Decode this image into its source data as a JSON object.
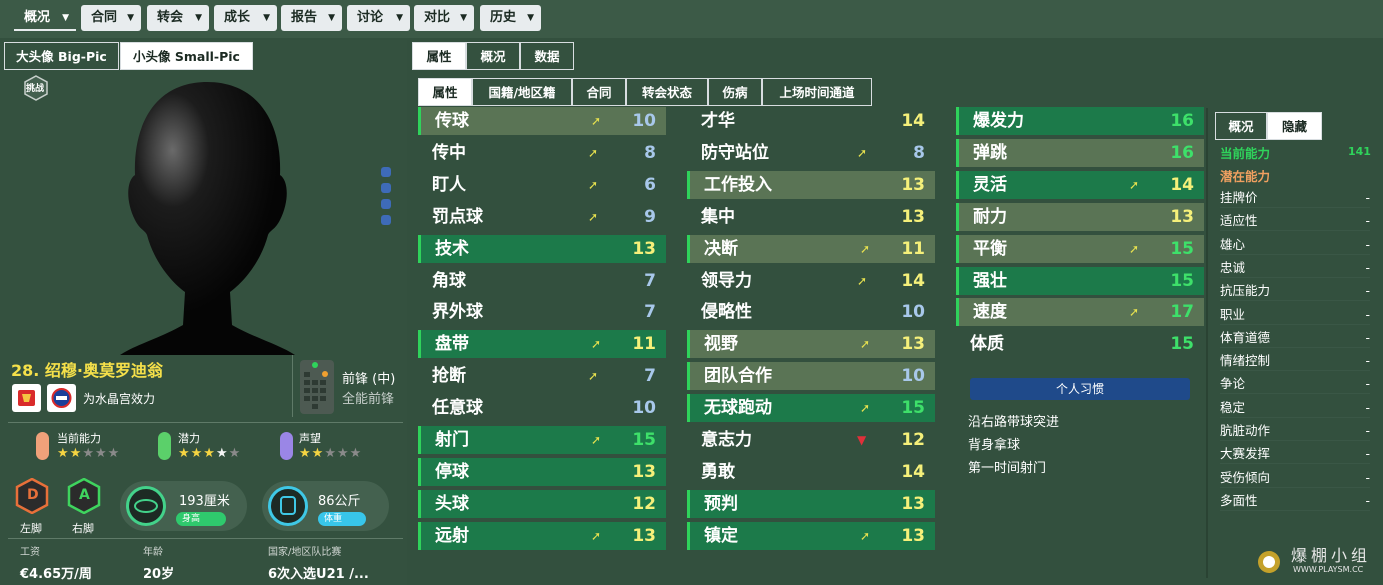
{
  "nav": {
    "items": [
      "概况",
      "合同",
      "转会",
      "成长",
      "报告",
      "讨论",
      "对比",
      "历史"
    ]
  },
  "portrait_tabs": {
    "big": "大头像 Big-Pic",
    "small": "小头像 Small-Pic"
  },
  "challenge_badge": "挑战",
  "player": {
    "name": "28. 绍穆·奥莫罗迪翁",
    "club_text": "为水晶宫效力",
    "position": "前锋 (中)",
    "role": "全能前锋",
    "ca_label": "当前能力",
    "pa_label": "潜力",
    "rep_label": "声望",
    "ca_stars": 2.5,
    "pa_stars": 3.5,
    "rep_stars": 2.5,
    "left_foot_grade": "D",
    "right_foot_grade": "A",
    "left_foot_label": "左脚",
    "right_foot_label": "右脚",
    "height_value": "193厘米",
    "height_label": "身高",
    "weight_value": "86公斤",
    "weight_label": "体重",
    "wage_label": "工资",
    "wage_value": "€4.65万/周",
    "age_label": "年龄",
    "age_value": "20岁",
    "intl_label": "国家/地区队比赛",
    "intl_value": "6次入选U21 /..."
  },
  "main_tabs": [
    "属性",
    "概况",
    "数据"
  ],
  "sub_tabs": [
    "属性",
    "国籍/地区籍",
    "合同",
    "转会状态",
    "伤病",
    "上场时间通道"
  ],
  "technical": [
    {
      "name": "传球",
      "value": "10",
      "hl": "hl",
      "arrow": "up"
    },
    {
      "name": "传中",
      "value": "8",
      "hl": "",
      "arrow": "up"
    },
    {
      "name": "盯人",
      "value": "6",
      "hl": "",
      "arrow": "up"
    },
    {
      "name": "罚点球",
      "value": "9",
      "hl": "",
      "arrow": "up"
    },
    {
      "name": "技术",
      "value": "13",
      "hl": "hlg",
      "arrow": ""
    },
    {
      "name": "角球",
      "value": "7",
      "hl": "",
      "arrow": ""
    },
    {
      "name": "界外球",
      "value": "7",
      "hl": "",
      "arrow": ""
    },
    {
      "name": "盘带",
      "value": "11",
      "hl": "hlg",
      "arrow": "up"
    },
    {
      "name": "抢断",
      "value": "7",
      "hl": "",
      "arrow": "up"
    },
    {
      "name": "任意球",
      "value": "10",
      "hl": "",
      "arrow": ""
    },
    {
      "name": "射门",
      "value": "15",
      "hl": "hlg",
      "arrow": "up"
    },
    {
      "name": "停球",
      "value": "13",
      "hl": "hlg",
      "arrow": ""
    },
    {
      "name": "头球",
      "value": "12",
      "hl": "hlg",
      "arrow": ""
    },
    {
      "name": "远射",
      "value": "13",
      "hl": "hlg",
      "arrow": "up"
    }
  ],
  "mental": [
    {
      "name": "才华",
      "value": "14",
      "hl": "",
      "arrow": ""
    },
    {
      "name": "防守站位",
      "value": "8",
      "hl": "",
      "arrow": "up"
    },
    {
      "name": "工作投入",
      "value": "13",
      "hl": "hl",
      "arrow": ""
    },
    {
      "name": "集中",
      "value": "13",
      "hl": "",
      "arrow": ""
    },
    {
      "name": "决断",
      "value": "11",
      "hl": "hl",
      "arrow": "up"
    },
    {
      "name": "领导力",
      "value": "14",
      "hl": "",
      "arrow": "up"
    },
    {
      "name": "侵略性",
      "value": "10",
      "hl": "",
      "arrow": ""
    },
    {
      "name": "视野",
      "value": "13",
      "hl": "hl",
      "arrow": "up"
    },
    {
      "name": "团队合作",
      "value": "10",
      "hl": "hl",
      "arrow": ""
    },
    {
      "name": "无球跑动",
      "value": "15",
      "hl": "hlg",
      "arrow": "up"
    },
    {
      "name": "意志力",
      "value": "12",
      "hl": "",
      "arrow": "down"
    },
    {
      "name": "勇敢",
      "value": "14",
      "hl": "",
      "arrow": ""
    },
    {
      "name": "预判",
      "value": "13",
      "hl": "hlg",
      "arrow": ""
    },
    {
      "name": "镇定",
      "value": "13",
      "hl": "hlg",
      "arrow": "up"
    }
  ],
  "physical": [
    {
      "name": "爆发力",
      "value": "16",
      "hl": "hlg",
      "arrow": ""
    },
    {
      "name": "弹跳",
      "value": "16",
      "hl": "hl",
      "arrow": ""
    },
    {
      "name": "灵活",
      "value": "14",
      "hl": "hlg",
      "arrow": "up"
    },
    {
      "name": "耐力",
      "value": "13",
      "hl": "hl",
      "arrow": ""
    },
    {
      "name": "平衡",
      "value": "15",
      "hl": "hl",
      "arrow": "up"
    },
    {
      "name": "强壮",
      "value": "15",
      "hl": "hlg",
      "arrow": ""
    },
    {
      "name": "速度",
      "value": "17",
      "hl": "hl",
      "arrow": "up"
    },
    {
      "name": "体质",
      "value": "15",
      "hl": "",
      "arrow": ""
    }
  ],
  "habits": {
    "title": "个人习惯",
    "items": [
      "沿右路带球突进",
      "背身拿球",
      "第一时间射门"
    ]
  },
  "side_tabs": [
    "概况",
    "隐藏"
  ],
  "side": {
    "ca_label": "当前能力",
    "ca_value": "141",
    "pa_label": "潜在能力",
    "pa_value": "",
    "rows": [
      {
        "label": "挂牌价",
        "value": "-"
      },
      {
        "label": "适应性",
        "value": "-"
      },
      {
        "label": "雄心",
        "value": "-"
      },
      {
        "label": "忠诚",
        "value": "-"
      },
      {
        "label": "抗压能力",
        "value": "-"
      },
      {
        "label": "职业",
        "value": "-"
      },
      {
        "label": "体育道德",
        "value": "-"
      },
      {
        "label": "情绪控制",
        "value": "-"
      },
      {
        "label": "争论",
        "value": "-"
      },
      {
        "label": "稳定",
        "value": "-"
      },
      {
        "label": "肮脏动作",
        "value": "-"
      },
      {
        "label": "大赛发挥",
        "value": "-"
      },
      {
        "label": "受伤倾向",
        "value": "-"
      },
      {
        "label": "多面性",
        "value": "-"
      }
    ]
  },
  "watermark": {
    "text": "爆棚小组",
    "sub": "WWW.PLAYSM.CC"
  },
  "colors": {
    "green_accent": "#2fd35b",
    "orange_pa": "#f0a060",
    "blue_habit": "#1f4a8a"
  }
}
